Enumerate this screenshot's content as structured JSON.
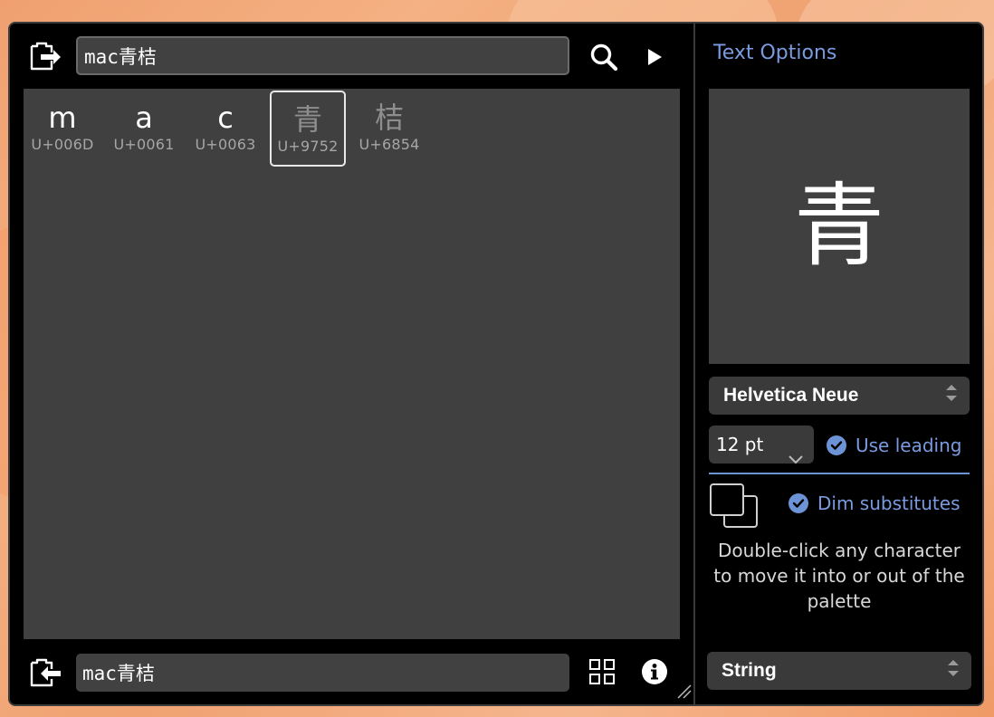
{
  "input": {
    "top_value": "mac青桔",
    "bottom_value": "mac青桔"
  },
  "palette": {
    "glyphs": [
      {
        "char": "m",
        "code": "U+006D",
        "dim": false,
        "selected": false
      },
      {
        "char": "a",
        "code": "U+0061",
        "dim": false,
        "selected": false
      },
      {
        "char": "c",
        "code": "U+0063",
        "dim": false,
        "selected": false
      },
      {
        "char": "青",
        "code": "U+9752",
        "dim": true,
        "selected": true
      },
      {
        "char": "桔",
        "code": "U+6854",
        "dim": true,
        "selected": false
      }
    ]
  },
  "options": {
    "title": "Text Options",
    "preview_char": "青",
    "font_name": "Helvetica Neue",
    "font_size": "12 pt",
    "use_leading_label": "Use leading",
    "use_leading_checked": true,
    "dim_substitutes_label": "Dim substitutes",
    "dim_substitutes_checked": true,
    "hint_text": "Double-click any character to move it into or out of the palette",
    "mode": "String"
  },
  "colors": {
    "accent": "#7a9be0",
    "panel_bg": "#404040",
    "window_bg": "#000000"
  },
  "icons": {
    "top_left": "clipboard-export-icon",
    "search": "search-icon",
    "play": "play-icon",
    "bottom_left": "clipboard-import-icon",
    "grid": "grid-view-icon",
    "info": "info-icon",
    "substitute": "overlapping-squares-icon"
  }
}
